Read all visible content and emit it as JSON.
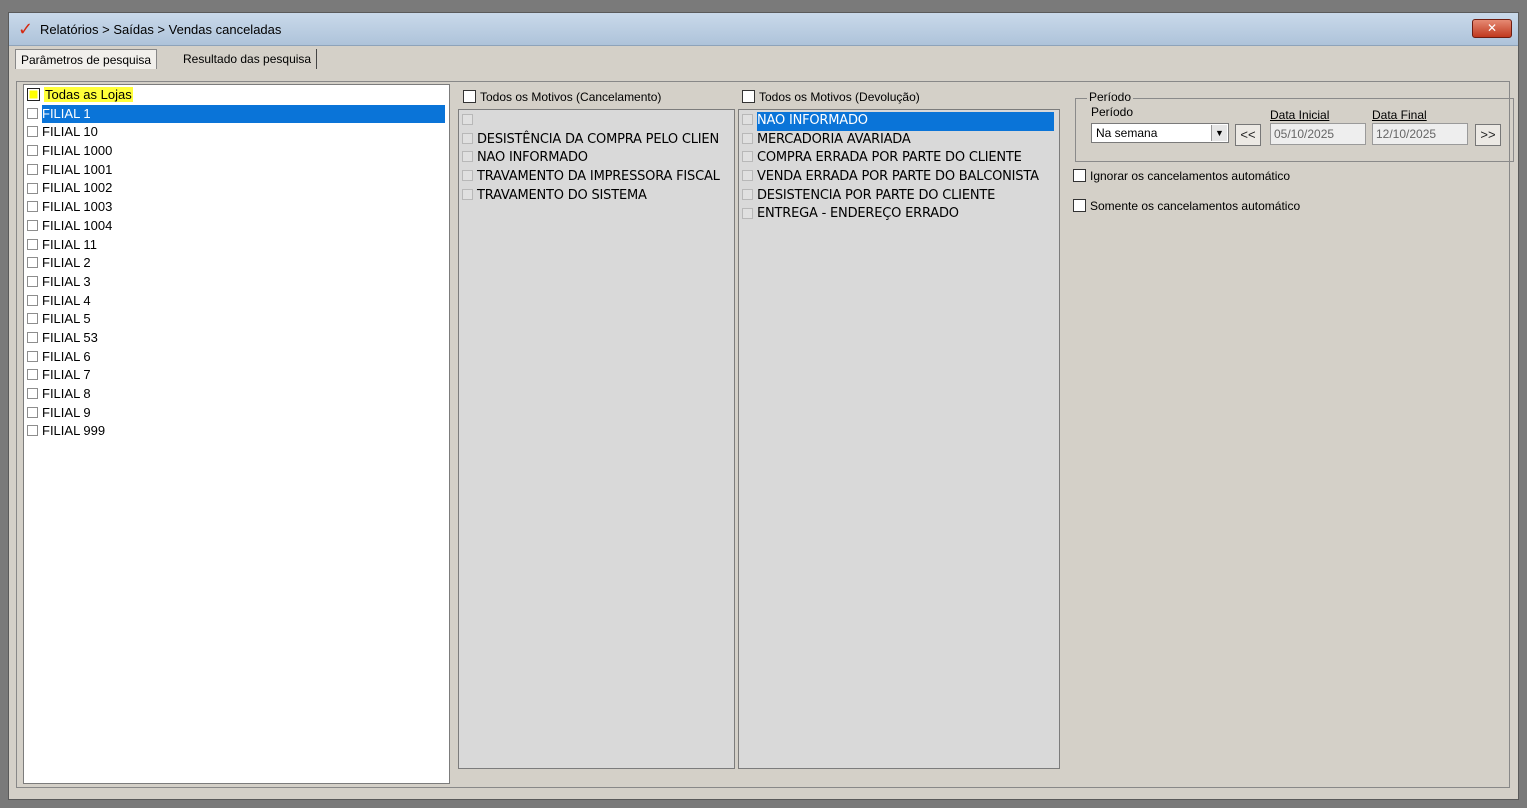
{
  "window": {
    "title": "Relatórios > Saídas > Vendas canceladas",
    "close_label": "✕"
  },
  "tabs": [
    {
      "label": "Parâmetros de pesquisa"
    },
    {
      "label": "Resultado das pesquisa"
    }
  ],
  "lojas": {
    "header": "Todas as Lojas",
    "items": [
      "FILIAL 1",
      "FILIAL 10",
      "FILIAL 1000",
      "FILIAL 1001",
      "FILIAL 1002",
      "FILIAL 1003",
      "FILIAL 1004",
      "FILIAL 11",
      "FILIAL 2",
      "FILIAL 3",
      "FILIAL 4",
      "FILIAL 5",
      "FILIAL 53",
      "FILIAL 6",
      "FILIAL 7",
      "FILIAL 8",
      "FILIAL 9",
      "FILIAL 999"
    ],
    "selected_index": 0
  },
  "cancelamento": {
    "header": "Todos os Motivos (Cancelamento)",
    "items": [
      "",
      "DESISTÊNCIA DA COMPRA PELO CLIEN",
      "NAO INFORMADO",
      "TRAVAMENTO DA IMPRESSORA FISCAL",
      "TRAVAMENTO DO SISTEMA"
    ]
  },
  "devolucao": {
    "header": "Todos os Motivos (Devolução)",
    "items": [
      "NAO INFORMADO",
      "MERCADORIA AVARIADA",
      "COMPRA ERRADA POR PARTE DO CLIENTE",
      "VENDA ERRADA POR PARTE DO BALCONISTA",
      "DESISTENCIA POR PARTE DO CLIENTE",
      "ENTREGA - ENDEREÇO ERRADO"
    ],
    "selected_index": 0
  },
  "periodo": {
    "group_label": "Período",
    "field_label": "Período",
    "selected": "Na semana",
    "data_inicial_label": "Data Inicial",
    "data_final_label": "Data Final",
    "data_inicial": "05/10/2025",
    "data_final": "12/10/2025",
    "prev_label": "<<",
    "next_label": ">>"
  },
  "options": {
    "ignorar": "Ignorar os cancelamentos automático",
    "somente": "Somente os cancelamentos automático"
  }
}
